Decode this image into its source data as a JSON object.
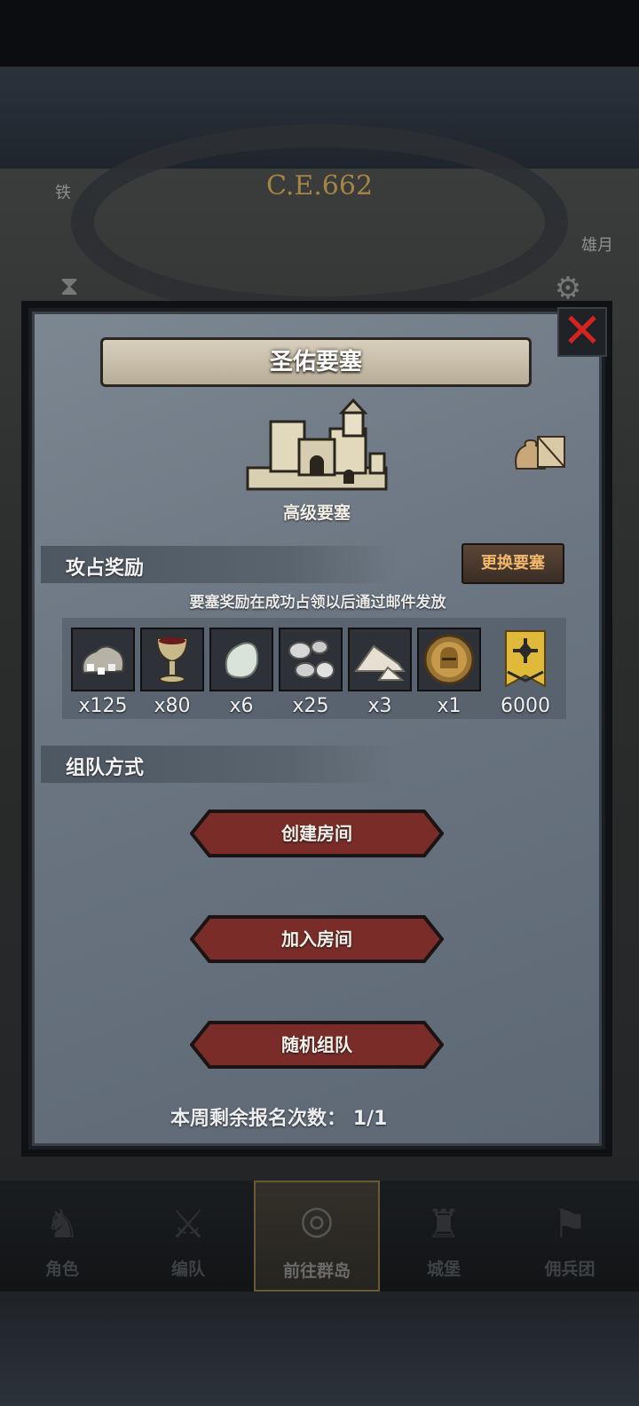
{
  "background": {
    "era": "C.E.662",
    "corner_left": "铁",
    "corner_right": "雄月"
  },
  "dialog": {
    "title": "圣佑要塞",
    "fortress_level": "高级要塞",
    "close_icon": "close-x-icon"
  },
  "rewards_section": {
    "title": "攻占奖励",
    "swap_button": "更换要塞",
    "hint": "要塞奖励在成功占领以后通过邮件发放",
    "items": [
      {
        "icon": "silver-ore-pile-icon",
        "qty": "x125"
      },
      {
        "icon": "goblet-icon",
        "qty": "x80"
      },
      {
        "icon": "moonstone-icon",
        "qty": "x6"
      },
      {
        "icon": "silver-nuggets-icon",
        "qty": "x25"
      },
      {
        "icon": "salt-pile-icon",
        "qty": "x3"
      },
      {
        "icon": "knight-helmet-medal-icon",
        "qty": "x1"
      },
      {
        "icon": "guild-banner-icon",
        "qty": "6000"
      }
    ]
  },
  "team_section": {
    "title": "组队方式",
    "create_room": "创建房间",
    "join_room": "加入房间",
    "random_team": "随机组队",
    "remaining_label": "本周剩余报名次数：",
    "remaining_value": "1/1"
  },
  "navbar": {
    "items": [
      {
        "label": "角色",
        "icon": "knight-icon"
      },
      {
        "label": "编队",
        "icon": "formation-icon"
      },
      {
        "label": "前往群岛",
        "icon": "compass-globe-icon"
      },
      {
        "label": "城堡",
        "icon": "castle-icon"
      },
      {
        "label": "佣兵团",
        "icon": "mercenary-flag-icon"
      }
    ],
    "active": "前往群岛"
  },
  "colors": {
    "accent_gold": "#a78443",
    "button_red": "#7a2d28",
    "swap_text": "#f2b76a",
    "close_red": "#d3241f"
  }
}
